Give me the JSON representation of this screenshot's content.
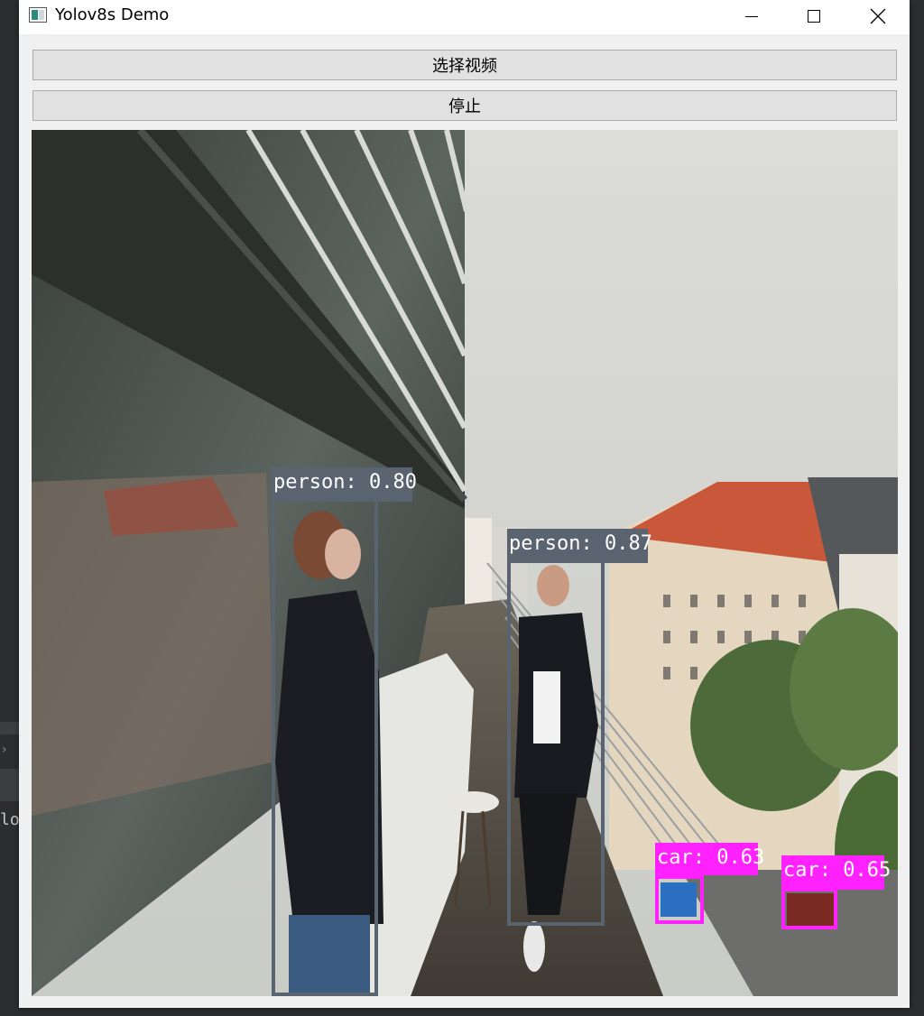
{
  "window": {
    "title": "Yolov8s Demo",
    "controls": {
      "minimize": "minimize-icon",
      "maximize": "maximize-icon",
      "close": "close-icon"
    }
  },
  "buttons": {
    "select_video": "选择视频",
    "stop": "停止"
  },
  "background": {
    "editor_text": "lo",
    "chevron": "›"
  },
  "detections": [
    {
      "label": "person: 0.80",
      "color": "#5a6470"
    },
    {
      "label": "person: 0.87",
      "color": "#5a6470"
    },
    {
      "label": "car: 0.63",
      "color": "#ff22ff"
    },
    {
      "label": "car: 0.65",
      "color": "#ff22ff"
    }
  ]
}
